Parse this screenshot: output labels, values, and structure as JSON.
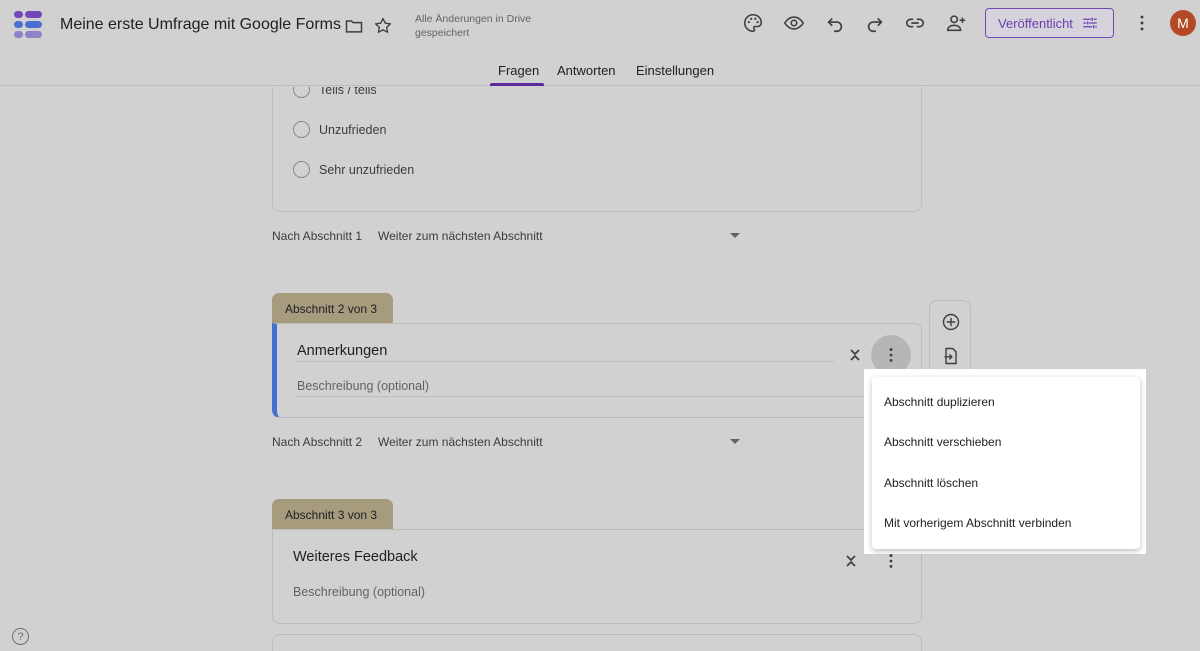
{
  "header": {
    "title": "Meine erste Umfrage mit Google Forms",
    "save_status": "Alle Änderungen in Drive gespeichert",
    "publish_label": "Veröffentlicht",
    "avatar_initial": "M"
  },
  "tabs": [
    {
      "label": "Fragen",
      "active": true
    },
    {
      "label": "Antworten",
      "active": false
    },
    {
      "label": "Einstellungen",
      "active": false
    }
  ],
  "question_options": [
    "Teils / teils",
    "Unzufrieden",
    "Sehr unzufrieden"
  ],
  "after_sections": [
    {
      "label": "Nach Abschnitt 1",
      "destination": "Weiter zum nächsten Abschnitt"
    },
    {
      "label": "Nach Abschnitt 2",
      "destination": "Weiter zum nächsten Abschnitt"
    }
  ],
  "sections": [
    {
      "tab_label": "Abschnitt 2 von 3",
      "title": "Anmerkungen",
      "description_placeholder": "Beschreibung (optional)"
    },
    {
      "tab_label": "Abschnitt 3 von 3",
      "title": "Weiteres Feedback",
      "description_placeholder": "Beschreibung (optional)"
    }
  ],
  "context_menu": {
    "items": [
      "Abschnitt duplizieren",
      "Abschnitt verschieben",
      "Abschnitt löschen",
      "Mit vorherigem Abschnitt verbinden"
    ]
  },
  "help": "?",
  "colors": {
    "accent": "#673ab7",
    "section_tab": "#a69b7c",
    "focus_bar": "#4471d0",
    "avatar": "#b44a25"
  }
}
